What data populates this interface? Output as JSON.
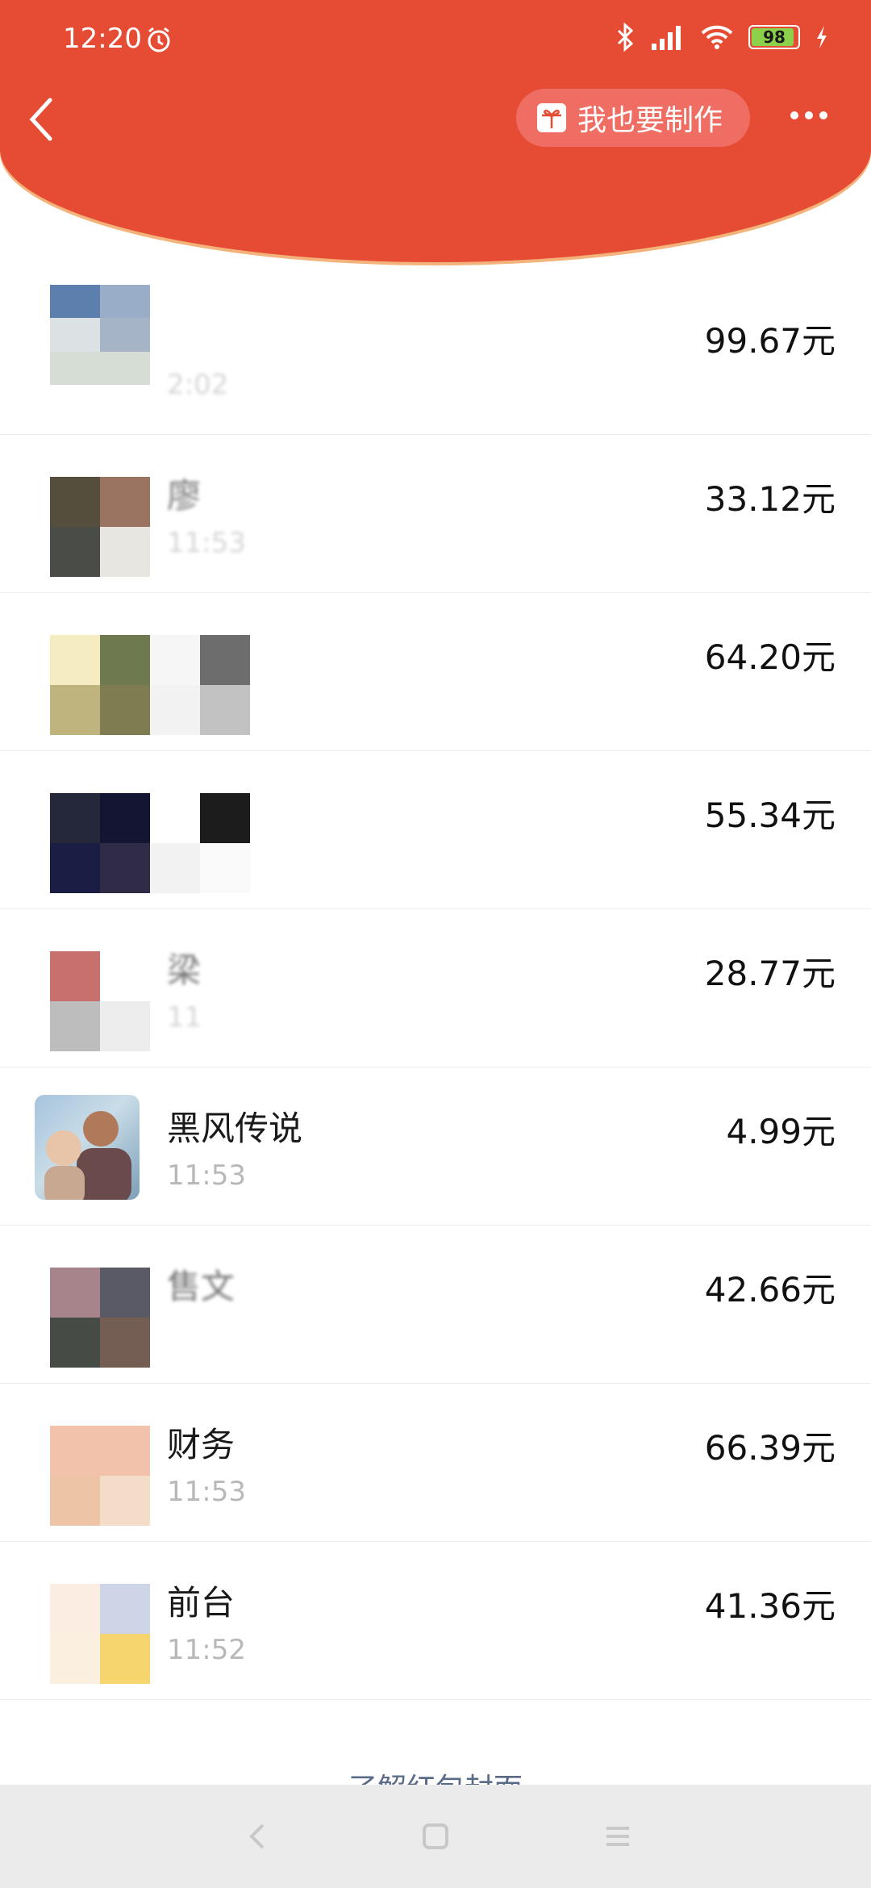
{
  "status_bar": {
    "time": "12:20",
    "battery": "98"
  },
  "header": {
    "make_button_label": "我也要制作"
  },
  "list": [
    {
      "amount": "99.67元",
      "name": "",
      "time": "2:02"
    },
    {
      "amount": "33.12元",
      "name": "廖",
      "time": "11:53"
    },
    {
      "amount": "64.20元",
      "name": "",
      "time": ""
    },
    {
      "amount": "55.34元",
      "name": "",
      "time": ""
    },
    {
      "amount": "28.77元",
      "name": "梁",
      "time": "11"
    },
    {
      "amount": "4.99元",
      "name": "黑风传说",
      "time": "11:53"
    },
    {
      "amount": "42.66元",
      "name": "售文",
      "time": ""
    },
    {
      "amount": "66.39元",
      "name": "财务",
      "time": "11:53"
    },
    {
      "amount": "41.36元",
      "name": "前台",
      "time": "11:52"
    }
  ],
  "footer": {
    "link_text": "了解红包封面"
  },
  "colors": {
    "header_red": "#e64b33",
    "button_pink": "#ef6d63",
    "link_blue": "#5a6b8a"
  }
}
